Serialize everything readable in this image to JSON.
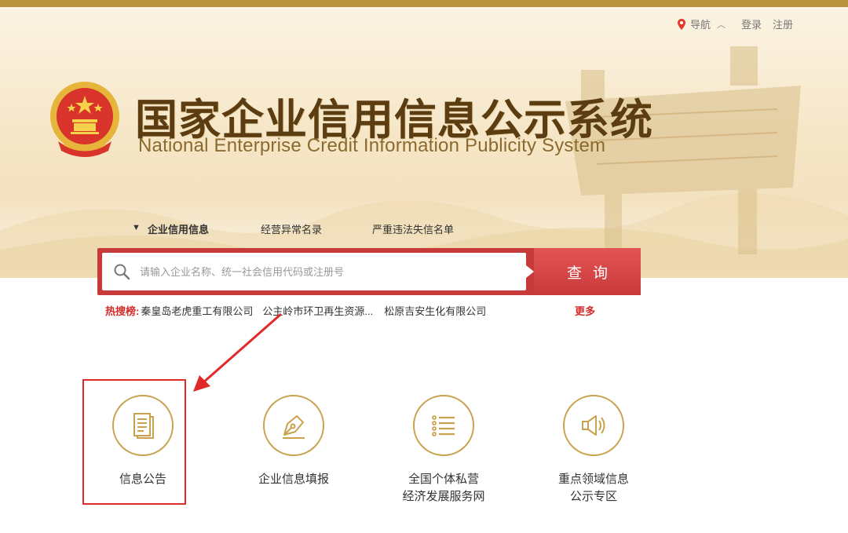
{
  "header": {
    "nav_label": "导航",
    "nav_caret": "︿",
    "login": "登录",
    "register": "注册",
    "title_cn": "国家企业信用信息公示系统",
    "title_en": "National Enterprise Credit Information Publicity System",
    "emblem_icon": "national-emblem-icon"
  },
  "tabs": [
    {
      "label": "企业信用信息",
      "active": true
    },
    {
      "label": "经营异常名录",
      "active": false
    },
    {
      "label": "严重违法失信名单",
      "active": false
    }
  ],
  "search": {
    "placeholder": "请输入企业名称、统一社会信用代码或注册号",
    "value": "",
    "button_label": "查询"
  },
  "hot": {
    "label": "热搜榜:",
    "items": [
      "秦皇岛老虎重工有限公司",
      "公主岭市环卫再生资源...",
      "松原吉安生化有限公司"
    ],
    "more": "更多"
  },
  "services": [
    {
      "label": "信息公告",
      "icon": "document-icon"
    },
    {
      "label": "企业信息填报",
      "icon": "pen-nib-icon"
    },
    {
      "label": "全国个体私营\n经济发展服务网",
      "icon": "list-icon"
    },
    {
      "label": "重点领域信息\n公示专区",
      "icon": "speaker-icon"
    }
  ],
  "colors": {
    "gold": "#c9a24e",
    "brown": "#5c3d12",
    "search_red": "#c93a3a",
    "annotation_red": "#e02a2a"
  }
}
